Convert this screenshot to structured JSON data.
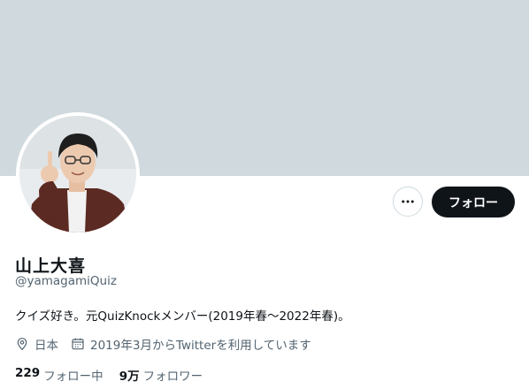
{
  "profile": {
    "display_name": "山上大喜",
    "handle": "@yamagamiQuiz",
    "bio": "クイズ好き。元QuizKnockメンバー(2019年春〜2022年春)。",
    "location": "日本",
    "joined": "2019年3月からTwitterを利用しています"
  },
  "actions": {
    "follow_label": "フォロー"
  },
  "stats": {
    "following_count": "229",
    "following_label": "フォロー中",
    "followers_count": "9万",
    "followers_label": "フォロワー"
  },
  "colors": {
    "banner": "#cfd9de",
    "primary_text": "#0f1419",
    "secondary_text": "#536471",
    "follow_button_bg": "#0f1419"
  },
  "icons": {
    "more": "more-horizontal-icon",
    "location": "location-pin-icon",
    "joined": "calendar-icon"
  }
}
